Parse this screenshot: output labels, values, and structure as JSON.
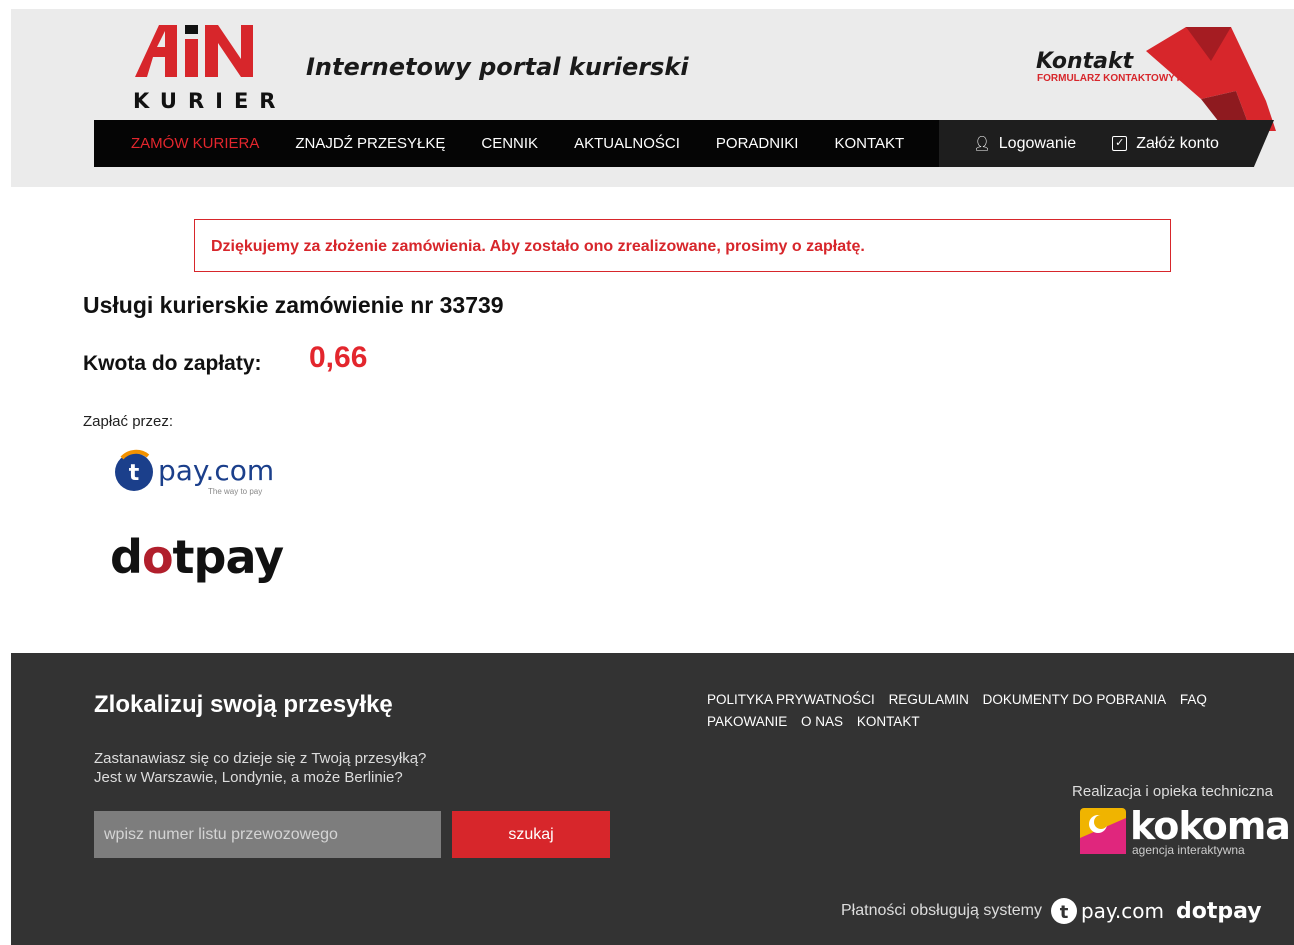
{
  "header": {
    "logo_text": "KURIER",
    "tagline": "Internetowy portal kurierski",
    "kontakt_title": "Kontakt",
    "kontakt_sub": "FORMULARZ KONTAKTOWY ▸"
  },
  "nav": {
    "items": [
      {
        "label": "ZAMÓW KURIERA"
      },
      {
        "label": "ZNAJDŹ PRZESYŁKĘ"
      },
      {
        "label": "CENNIK"
      },
      {
        "label": "AKTUALNOŚCI"
      },
      {
        "label": "PORADNIKI"
      },
      {
        "label": "KONTAKT"
      }
    ],
    "login": "Logowanie",
    "register": "Załóż konto"
  },
  "main": {
    "alert": "Dziękujemy za złożenie zamówienia. Aby zostało ono zrealizowane, prosimy o zapłatę.",
    "order_title": "Usługi kurierskie zamówienie nr 33739",
    "amount_label": "Kwota do zapłaty:",
    "amount_value": "0,66",
    "pay_label": "Zapłać przez:",
    "tpay_brand": "pay.com",
    "tpay_slogan": "The way to pay",
    "dotpay_brand_a": "d",
    "dotpay_brand_b": "o",
    "dotpay_brand_c": "tpay"
  },
  "footer": {
    "title": "Zlokalizuj swoją przesyłkę",
    "text_line1": "Zastanawiasz się co dzieje się z Twoją przesyłką?",
    "text_line2": "Jest w Warszawie, Londynie, a może Berlinie?",
    "input_placeholder": "wpisz numer listu przewozowego",
    "search_button": "szukaj",
    "links": [
      "POLITYKA PRYWATNOŚCI",
      "REGULAMIN",
      "DOKUMENTY DO POBRANIA",
      "FAQ",
      "PAKOWANIE",
      "O NAS",
      "KONTAKT"
    ],
    "realization": "Realizacja i opieka techniczna",
    "kokoma_word": "kokoma",
    "kokoma_sub": "agencja interaktywna",
    "payments_text": "Płatności obsługują systemy",
    "tpay_brand": "pay.com",
    "dotpay_brand": "dotpay"
  },
  "colors": {
    "accent": "#d7262b",
    "footer_bg": "#333333",
    "header_bg": "#ebebeb"
  }
}
